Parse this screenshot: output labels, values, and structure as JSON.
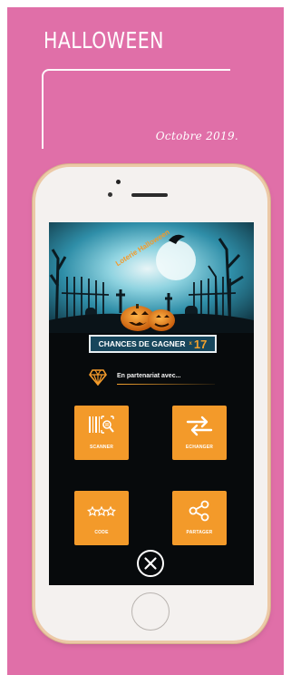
{
  "page": {
    "title": "HALLOWEEN",
    "subtitle": "Octobre 2019."
  },
  "app": {
    "hero_sign": "Loterie Halloween",
    "chances": {
      "label": "CHANCES DE GAGNER",
      "multiplier": "x",
      "count": "17"
    },
    "partner_text": "En partenariat avec...",
    "tiles": [
      {
        "label": "SCANNER",
        "icon": "barcode-scan-icon"
      },
      {
        "label": "ECHANGER",
        "icon": "swap-arrows-icon"
      },
      {
        "label": "CODE",
        "icon": "stars-code-icon"
      },
      {
        "label": "PARTAGER",
        "icon": "share-icon"
      }
    ]
  },
  "colors": {
    "background": "#e06fa8",
    "accent_orange": "#f39a2a",
    "chances_bg": "#17465c",
    "phone_frame": "#ecc9a6"
  }
}
